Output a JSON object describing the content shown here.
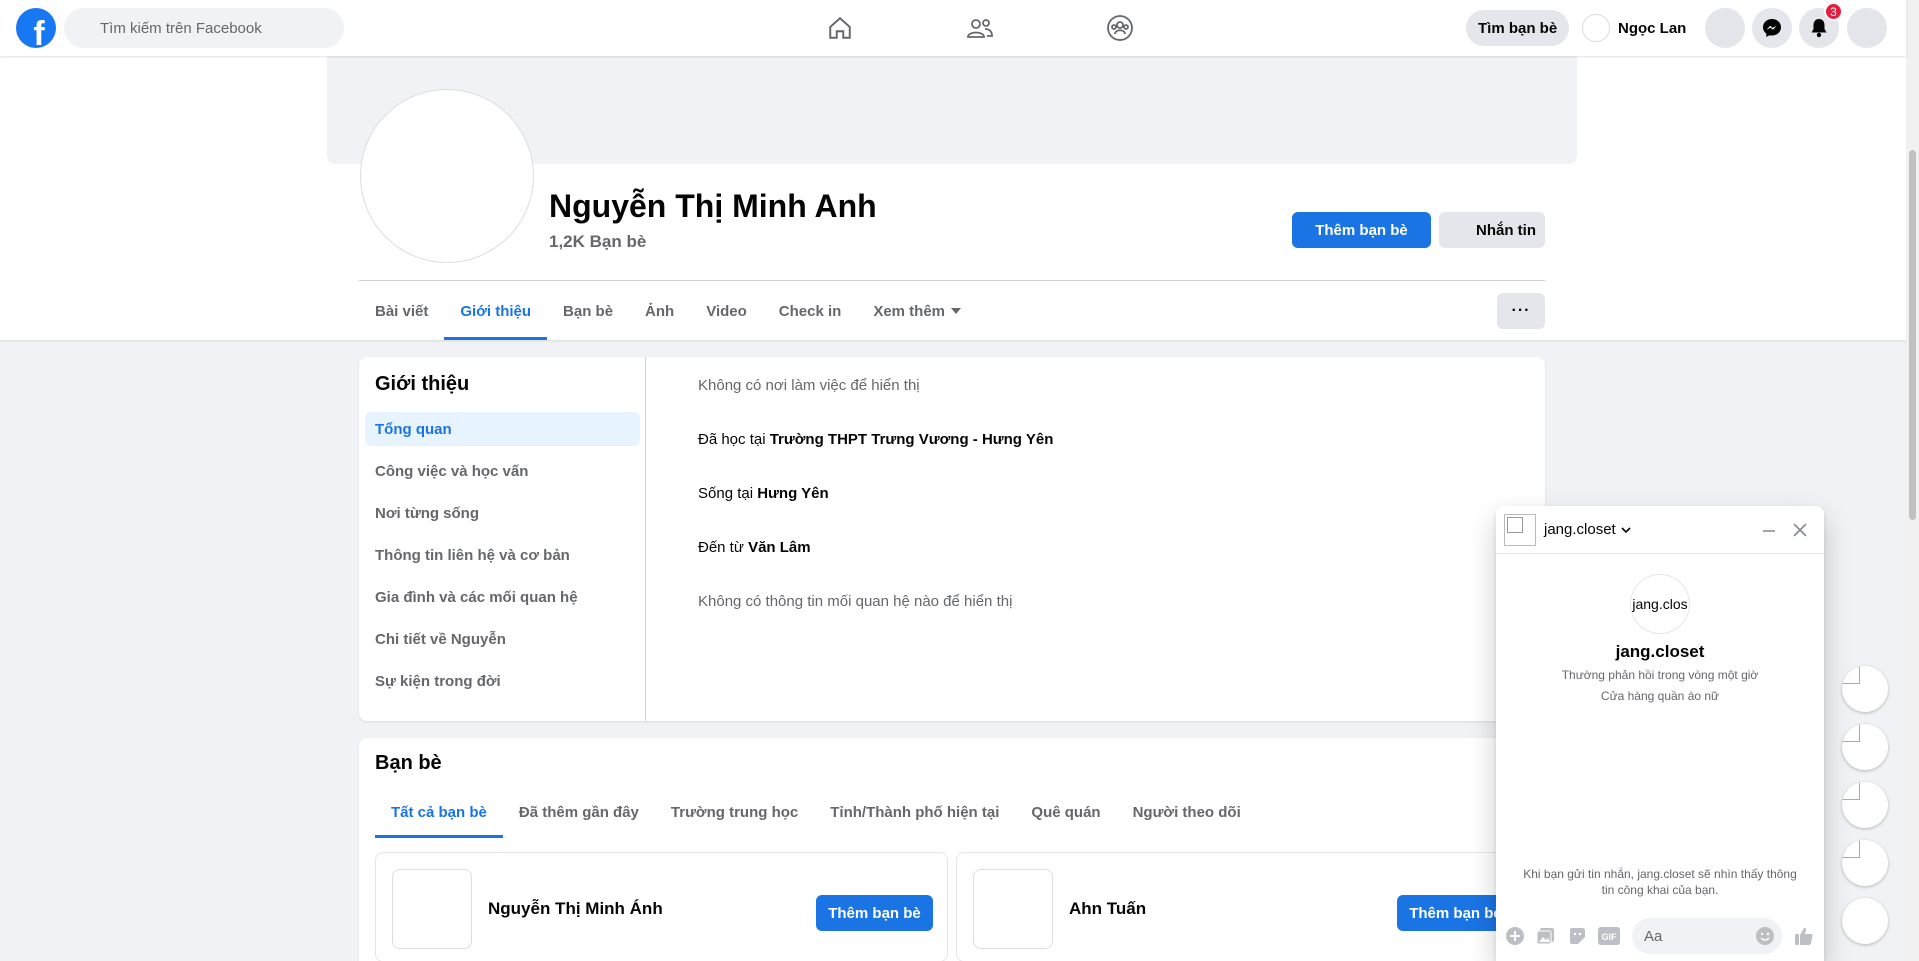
{
  "topbar": {
    "search_placeholder": "Tìm kiếm trên Facebook",
    "find_friends": "Tìm bạn bè",
    "user_name": "Ngọc Lan",
    "notification_count": "3"
  },
  "profile": {
    "name": "Nguyễn Thị Minh Anh",
    "friend_count": "1,2K Bạn bè",
    "add_friend": "Thêm bạn bè",
    "message": "Nhắn tin",
    "more": "···"
  },
  "tabs": [
    {
      "label": "Bài viết"
    },
    {
      "label": "Giới thiệu"
    },
    {
      "label": "Bạn bè"
    },
    {
      "label": "Ảnh"
    },
    {
      "label": "Video"
    },
    {
      "label": "Check in"
    },
    {
      "label": "Xem thêm"
    }
  ],
  "about": {
    "title": "Giới thiệu",
    "menu": [
      {
        "label": "Tổng quan"
      },
      {
        "label": "Công việc và học vấn"
      },
      {
        "label": "Nơi từng sống"
      },
      {
        "label": "Thông tin liên hệ và cơ bản"
      },
      {
        "label": "Gia đình và các mối quan hệ"
      },
      {
        "label": "Chi tiết về Nguyễn"
      },
      {
        "label": "Sự kiện trong đời"
      }
    ],
    "work": "Không có nơi làm việc để hiển thị",
    "studied_prefix": "Đã học tại ",
    "studied_value": "Trường THPT Trưng Vương - Hưng Yên",
    "lives_prefix": "Sống tại ",
    "lives_value": "Hưng Yên",
    "from_prefix": "Đến từ ",
    "from_value": "Văn Lâm",
    "relationship": "Không có thông tin mối quan hệ nào để hiển thị"
  },
  "friends": {
    "title": "Bạn bè",
    "tabs": [
      {
        "label": "Tất cả bạn bè"
      },
      {
        "label": "Đã thêm gần đây"
      },
      {
        "label": "Trường trung học"
      },
      {
        "label": "Tỉnh/Thành phố hiện tại"
      },
      {
        "label": "Quê quán"
      },
      {
        "label": "Người theo dõi"
      }
    ],
    "items": [
      {
        "name": "Nguyễn Thị Minh Ánh",
        "button": "Thêm bạn bè"
      },
      {
        "name": "Ahn Tuấn",
        "button": "Thêm bạn bè"
      }
    ]
  },
  "chat": {
    "name": "jang.closet",
    "avatar_alt": "jang.clos",
    "title": "jang.closet",
    "response_time": "Thường phản hồi trong vòng một giờ",
    "category": "Cửa hàng quần áo nữ",
    "privacy_note": "Khi bạn gửi tin nhắn, jang.closet sẽ nhìn thấy thông tin công khai của bạn.",
    "input_placeholder": "Aa",
    "gif_label": "GIF"
  },
  "colors": {
    "brand": "#1877f2",
    "primary_button": "#1b74e4",
    "badge": "#e41e3f"
  },
  "icons": [
    "facebook-logo-icon",
    "search-icon",
    "home-icon",
    "friends-icon",
    "groups-icon",
    "messenger-icon",
    "bell-icon",
    "chevron-down-icon",
    "minimize-icon",
    "close-icon",
    "plus-icon",
    "photo-icon",
    "sticker-icon",
    "gif-icon",
    "emoji-icon",
    "like-icon"
  ]
}
